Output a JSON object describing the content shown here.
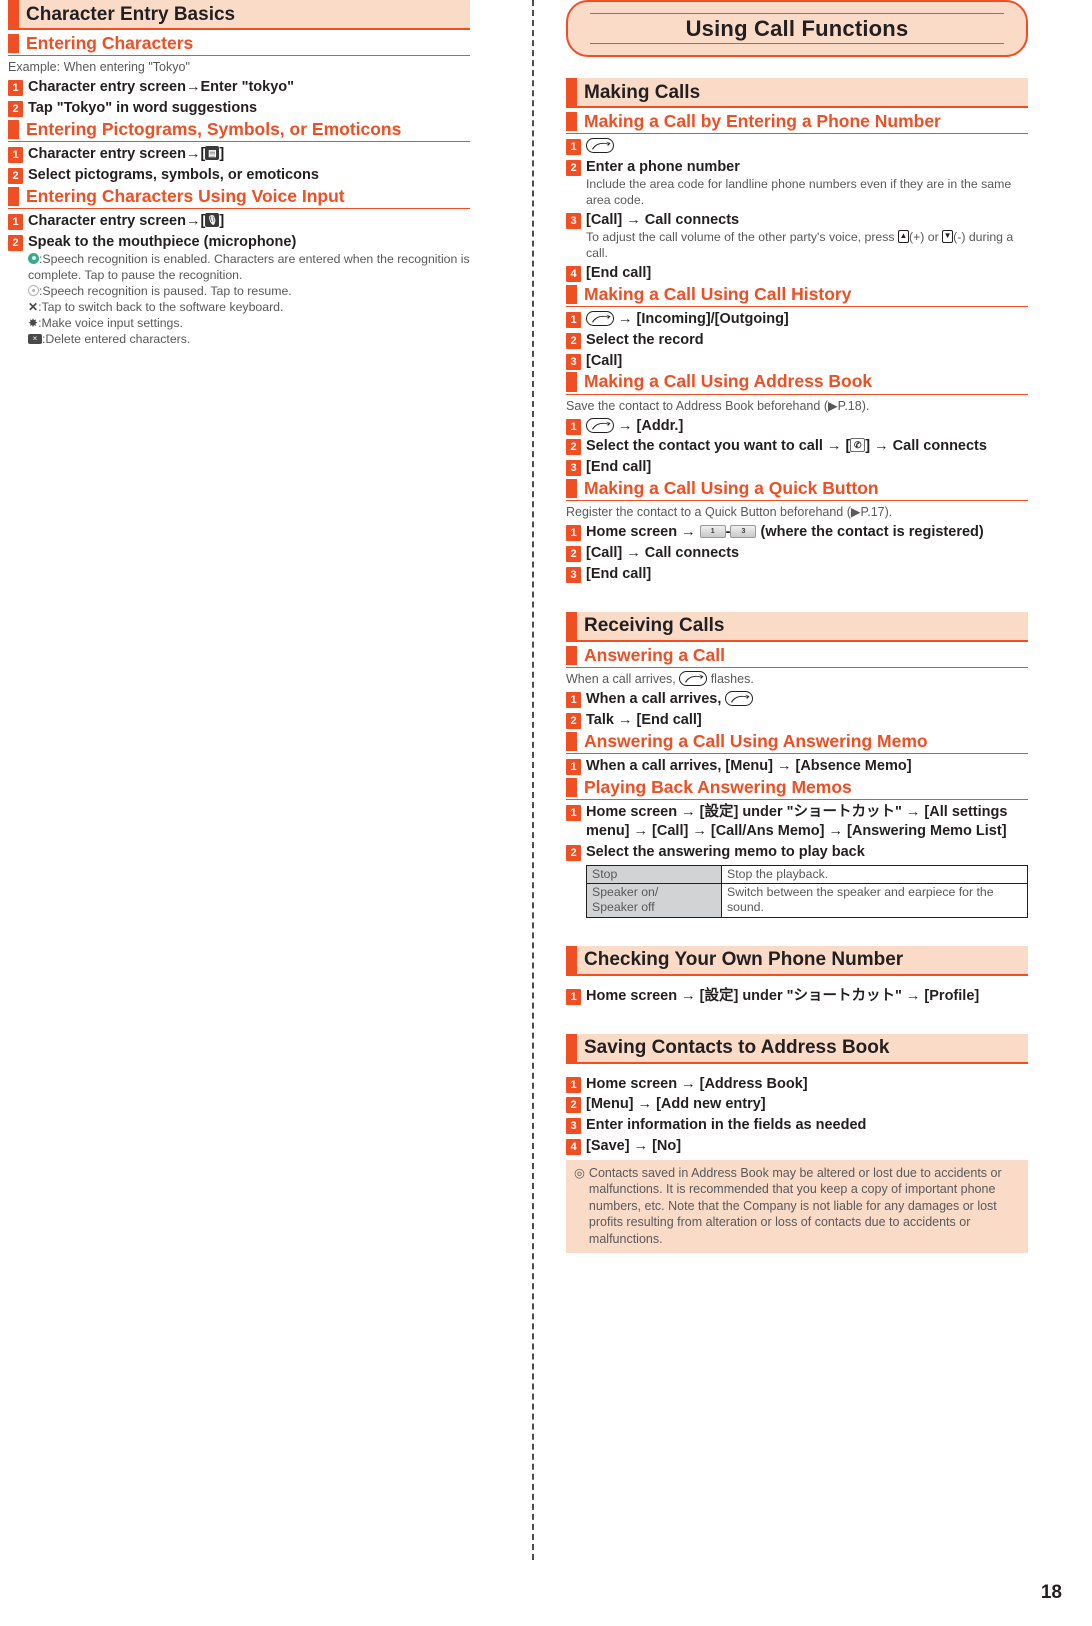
{
  "page_number": "18",
  "left_column": {
    "chapter_heading": "Character Entry Basics",
    "sections": [
      {
        "heading": "Entering Characters",
        "intro": "Example: When entering \"Tokyo\"",
        "steps": [
          {
            "num": "1",
            "title_parts": [
              "Character entry screen",
              " → ",
              "Enter \"tokyo\""
            ]
          },
          {
            "num": "2",
            "title_parts": [
              "Tap \"Tokyo\" in word suggestions"
            ]
          }
        ]
      },
      {
        "heading": "Entering Pictograms, Symbols, or Emoticons",
        "steps": [
          {
            "num": "1",
            "title_parts": [
              "Character entry screen",
              " → ",
              "[",
              "pictogram-key-icon",
              "]"
            ]
          },
          {
            "num": "2",
            "title_parts": [
              "Select pictograms, symbols, or emoticons"
            ]
          }
        ]
      },
      {
        "heading": "Entering Characters Using Voice Input",
        "steps": [
          {
            "num": "1",
            "title_parts": [
              "Character entry screen",
              " → ",
              "[",
              "microphone-key-icon",
              "]"
            ]
          },
          {
            "num": "2",
            "title_parts": [
              "Speak to the mouthpiece (microphone)"
            ]
          }
        ],
        "voice_legend": [
          {
            "icon": "green-dot-icon",
            "text": ":Speech recognition is enabled. Characters are entered when the recognition is complete. Tap to pause the recognition."
          },
          {
            "icon": "grey-dot-icon",
            "text": ":Speech recognition is paused. Tap to resume."
          },
          {
            "icon": "x-icon",
            "text": ":Tap to switch back to the software keyboard."
          },
          {
            "icon": "gear-icon",
            "text": ":Make voice input settings."
          },
          {
            "icon": "delete-key-icon",
            "text": ":Delete entered characters."
          }
        ]
      }
    ]
  },
  "right_column": {
    "banner_title": "Using Call Functions",
    "sections": [
      {
        "title": "Making Calls",
        "subsections": [
          {
            "heading": "Making a Call by Entering a Phone Number",
            "steps": [
              {
                "num": "1",
                "icon": "call-key-icon",
                "title": ""
              },
              {
                "num": "2",
                "title": "Enter a phone number",
                "sub": "Include the area code for landline phone numbers even if they are in the same area code."
              },
              {
                "num": "3",
                "title": "[Call] → Call connects",
                "sub_pre": "To adjust the call volume of the other party's voice, press ",
                "sub_icon1": "volume-up-key-icon",
                "sub_mid": "(+) or ",
                "sub_icon2": "volume-down-key-icon",
                "sub_post": "(-) during a call."
              },
              {
                "num": "4",
                "title": "[End call]"
              }
            ]
          },
          {
            "heading": "Making a Call Using Call History",
            "steps": [
              {
                "num": "1",
                "icon": "call-key-icon",
                "title_after": " → [Incoming]/[Outgoing]"
              },
              {
                "num": "2",
                "title": "Select the record"
              },
              {
                "num": "3",
                "title": "[Call]"
              }
            ]
          },
          {
            "heading": "Making a Call Using Address Book",
            "intro": "Save the contact to Address Book beforehand (▶P.18).",
            "steps": [
              {
                "num": "1",
                "icon": "call-key-icon",
                "title_after": " → [Addr.]"
              },
              {
                "num": "2",
                "title_pre": "Select the contact you want to call → [",
                "inline_icon": "handset-icon",
                "title_post": "] → Call connects"
              },
              {
                "num": "3",
                "title": "[End call]"
              }
            ]
          },
          {
            "heading": "Making a Call Using a Quick Button",
            "intro": "Register the contact to a Quick Button beforehand (▶P.17).",
            "steps": [
              {
                "num": "1",
                "title_pre": "Home screen → ",
                "inline_icon": "quick-button-1-icon",
                "title_mid": "-",
                "inline_icon2": "quick-button-3-icon",
                "title_post": " (where the contact is registered)"
              },
              {
                "num": "2",
                "title": "[Call] → Call connects"
              },
              {
                "num": "3",
                "title": "[End call]"
              }
            ]
          }
        ]
      },
      {
        "title": "Receiving Calls",
        "subsections": [
          {
            "heading": "Answering a Call",
            "intro_pre": "When a call arrives, ",
            "intro_icon": "call-key-icon",
            "intro_post": " flashes.",
            "steps": [
              {
                "num": "1",
                "title_pre": "When a call arrives, ",
                "inline_icon": "call-key-icon",
                "title_post": ""
              },
              {
                "num": "2",
                "title": "Talk → [End call]"
              }
            ]
          },
          {
            "heading": "Answering a Call Using Answering Memo",
            "steps": [
              {
                "num": "1",
                "title": "When a call arrives, [Menu] → [Absence Memo]"
              }
            ]
          },
          {
            "heading": "Playing Back Answering Memos",
            "steps": [
              {
                "num": "1",
                "title": "Home screen → [設定] under \"ショートカット\" → [All settings menu] → [Call] → [Call/Ans Memo] → [Answering Memo List]"
              },
              {
                "num": "2",
                "title": "Select the answering memo to play back"
              }
            ],
            "table": {
              "rows": [
                {
                  "key": "Stop",
                  "value": "Stop the playback."
                },
                {
                  "key": "Speaker on/\nSpeaker off",
                  "value": "Switch between the speaker and earpiece for the sound."
                }
              ]
            }
          }
        ]
      },
      {
        "title": "Checking Your Own Phone Number",
        "subsections": [
          {
            "heading": null,
            "steps": [
              {
                "num": "1",
                "title": "Home screen → [設定] under \"ショートカット\" → [Profile]"
              }
            ]
          }
        ]
      },
      {
        "title": "Saving Contacts to Address Book",
        "subsections": [
          {
            "heading": null,
            "steps": [
              {
                "num": "1",
                "title": "Home screen → [Address Book]"
              },
              {
                "num": "2",
                "title": "[Menu] → [Add new entry]"
              },
              {
                "num": "3",
                "title": "Enter information in the fields as needed"
              },
              {
                "num": "4",
                "title": "[Save] → [No]"
              }
            ],
            "note": {
              "bullet": "◎",
              "text": "Contacts saved in Address Book may be altered or lost due to accidents or malfunctions. It is recommended that you keep a copy of important phone numbers, etc. Note that the Company is not liable for any damages or lost profits resulting from alteration or loss of contacts due to accidents or malfunctions."
            }
          }
        ]
      }
    ]
  },
  "colors": {
    "accent_orange": "#f04e23",
    "peach_bg": "#fadbc8",
    "body_grey": "#58595b",
    "table_key_bg": "#d2d3d5"
  }
}
